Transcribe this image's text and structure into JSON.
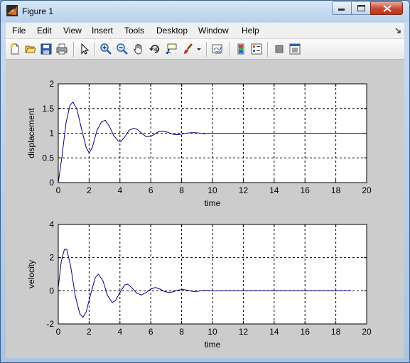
{
  "window": {
    "title": "Figure 1"
  },
  "menu": {
    "items": [
      "File",
      "Edit",
      "View",
      "Insert",
      "Tools",
      "Desktop",
      "Window",
      "Help"
    ]
  },
  "toolbar": {
    "icons": [
      "new-figure-icon",
      "open-file-icon",
      "save-icon",
      "print-icon",
      "edit-plot-arrow-icon",
      "zoom-in-icon",
      "zoom-out-icon",
      "pan-hand-icon",
      "rotate-3d-icon",
      "data-cursor-icon",
      "brush-icon",
      "brush-dropdown-icon",
      "link-plot-icon",
      "colorbar-icon",
      "legend-icon",
      "hide-plot-tools-icon",
      "show-plot-tools-icon"
    ]
  },
  "chart_data": [
    {
      "type": "line",
      "xlabel": "time",
      "ylabel": "displacement",
      "xlim": [
        0,
        20
      ],
      "ylim": [
        0,
        2
      ],
      "xticks": [
        "0",
        "2",
        "4",
        "6",
        "8",
        "10",
        "12",
        "14",
        "16",
        "18",
        "20"
      ],
      "yticks": [
        "0",
        "0.5",
        "1",
        "1.5",
        "2"
      ],
      "grid": true,
      "series": [
        {
          "color": "#00007f",
          "x": [
            0,
            0.25,
            0.5,
            0.75,
            0.95,
            1.2,
            1.5,
            1.8,
            2.0,
            2.2,
            2.5,
            2.8,
            3.05,
            3.3,
            3.6,
            3.9,
            4.05,
            4.3,
            4.6,
            4.9,
            5.1,
            5.4,
            5.7,
            6.0,
            6.2,
            6.5,
            6.8,
            7.1,
            7.4,
            7.7,
            8.0,
            8.3,
            8.6,
            8.9,
            9.2,
            9.5,
            9.8,
            10.1,
            10.5,
            11,
            12,
            13,
            14,
            15,
            16,
            17,
            18,
            19,
            20
          ],
          "y": [
            0,
            0.55,
            1.2,
            1.56,
            1.63,
            1.5,
            1.1,
            0.72,
            0.6,
            0.7,
            1.05,
            1.23,
            1.26,
            1.15,
            0.95,
            0.84,
            0.83,
            0.92,
            1.06,
            1.1,
            1.08,
            1.0,
            0.93,
            0.94,
            0.97,
            1.03,
            1.04,
            1.02,
            0.98,
            0.97,
            0.98,
            1.0,
            1.01,
            1.01,
            1.0,
            0.99,
            1.0,
            1.0,
            1.0,
            1.0,
            1.0,
            1.0,
            1.0,
            1.0,
            1.0,
            1.0,
            1.0,
            1.0,
            1.0
          ]
        }
      ]
    },
    {
      "type": "line",
      "xlabel": "time",
      "ylabel": "velocity",
      "xlim": [
        0,
        20
      ],
      "ylim": [
        -2,
        4
      ],
      "xticks": [
        "0",
        "2",
        "4",
        "6",
        "8",
        "10",
        "12",
        "14",
        "16",
        "18",
        "20"
      ],
      "yticks": [
        "-2",
        "0",
        "2",
        "4"
      ],
      "grid": true,
      "series": [
        {
          "color": "#00007f",
          "x": [
            0,
            0.2,
            0.4,
            0.55,
            0.8,
            1.1,
            1.4,
            1.6,
            1.8,
            2.1,
            2.4,
            2.6,
            2.9,
            3.2,
            3.5,
            3.7,
            4.0,
            4.3,
            4.5,
            4.8,
            5.1,
            5.4,
            5.7,
            6.0,
            6.3,
            6.6,
            6.9,
            7.2,
            7.5,
            7.8,
            8.1,
            8.4,
            8.7,
            9.0,
            9.3,
            9.6,
            9.9,
            10.2,
            10.6,
            11,
            12,
            13,
            14,
            15,
            16,
            17,
            18,
            19
          ],
          "y": [
            0.2,
            1.8,
            2.5,
            2.5,
            1.5,
            -0.3,
            -1.4,
            -1.6,
            -1.3,
            -0.2,
            0.8,
            1.0,
            0.6,
            -0.3,
            -0.7,
            -0.6,
            -0.1,
            0.35,
            0.4,
            0.15,
            -0.15,
            -0.25,
            -0.1,
            0.1,
            0.2,
            0.1,
            -0.05,
            -0.1,
            -0.05,
            0.05,
            0.08,
            0.03,
            -0.04,
            -0.04,
            0.0,
            0.02,
            0.0,
            -0.01,
            0.0,
            0.0,
            0.0,
            0.0,
            0.0,
            0.0,
            0.0,
            0.0,
            0.0,
            0.0
          ]
        }
      ]
    }
  ]
}
